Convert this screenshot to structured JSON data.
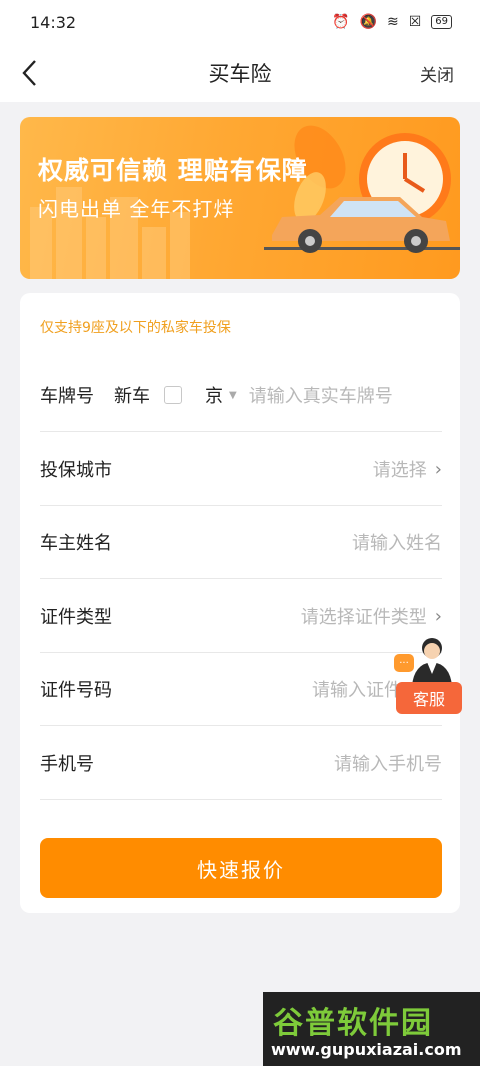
{
  "status_bar": {
    "time": "14:32",
    "battery": "69"
  },
  "nav": {
    "title": "买车险",
    "close_label": "关闭"
  },
  "banner": {
    "title": "权威可信赖  理赔有保障",
    "subtitle": "闪电出单  全年不打烊"
  },
  "form": {
    "notice": "仅支持9座及以下的私家车投保",
    "plate": {
      "label": "车牌号",
      "new_car_label": "新车",
      "new_car_checked": false,
      "province": "京",
      "placeholder": "请输入真实车牌号"
    },
    "rows": [
      {
        "label": "投保城市",
        "placeholder": "请选择",
        "has_chevron": true
      },
      {
        "label": "车主姓名",
        "placeholder": "请输入姓名",
        "has_chevron": false
      },
      {
        "label": "证件类型",
        "placeholder": "请选择证件类型",
        "has_chevron": true
      },
      {
        "label": "证件号码",
        "placeholder": "请输入证件",
        "has_chevron": false
      },
      {
        "label": "手机号",
        "placeholder": "请输入手机号",
        "has_chevron": false
      }
    ],
    "submit_label": "快速报价"
  },
  "service": {
    "label": "客服",
    "bubble": "···"
  },
  "watermark": {
    "title": "谷普软件园",
    "url": "www.gupuxiazai.com"
  },
  "colors": {
    "accent": "#ff8c00",
    "notice": "#f0a020",
    "service": "#f5673a"
  }
}
